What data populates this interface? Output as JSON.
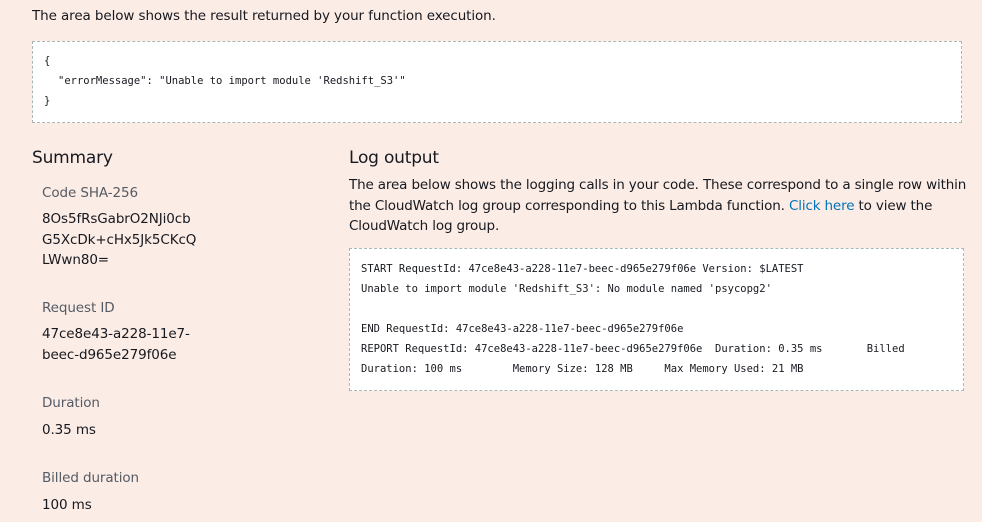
{
  "intro_text": "The area below shows the result returned by your function execution.",
  "result": {
    "open_brace": "{",
    "error_line": "\"errorMessage\": \"Unable to import module 'Redshift_S3'\"",
    "close_brace": "}"
  },
  "summary": {
    "heading": "Summary",
    "code_sha_label": "Code SHA-256",
    "code_sha_lines": [
      "8Os5fRsGabrO2NJi0cb",
      "G5XcDk+cHx5Jk5CKcQ",
      "LWwn80="
    ],
    "request_id_label": "Request ID",
    "request_id_lines": [
      "47ce8e43-a228-11e7-",
      "beec-d965e279f06e"
    ],
    "duration_label": "Duration",
    "duration_value": "0.35 ms",
    "billed_duration_label": "Billed duration",
    "billed_duration_value": "100 ms"
  },
  "log_output": {
    "heading": "Log output",
    "description_before_link": "The area below shows the logging calls in your code. These correspond to a single row within the CloudWatch log group corresponding to this Lambda function. ",
    "link_text": "Click here",
    "description_after_link": " to view the CloudWatch log group.",
    "lines": [
      "START RequestId: 47ce8e43-a228-11e7-beec-d965e279f06e Version: $LATEST",
      "Unable to import module 'Redshift_S3': No module named 'psycopg2'",
      "",
      "END RequestId: 47ce8e43-a228-11e7-beec-d965e279f06e",
      "REPORT RequestId: 47ce8e43-a228-11e7-beec-d965e279f06e  Duration: 0.35 ms       Billed",
      "Duration: 100 ms        Memory Size: 128 MB     Max Memory Used: 21 MB"
    ]
  },
  "colors": {
    "page_background": "#fcece6",
    "link": "#0073bb",
    "label_gray": "#545b64",
    "box_border": "#aab7b8"
  }
}
